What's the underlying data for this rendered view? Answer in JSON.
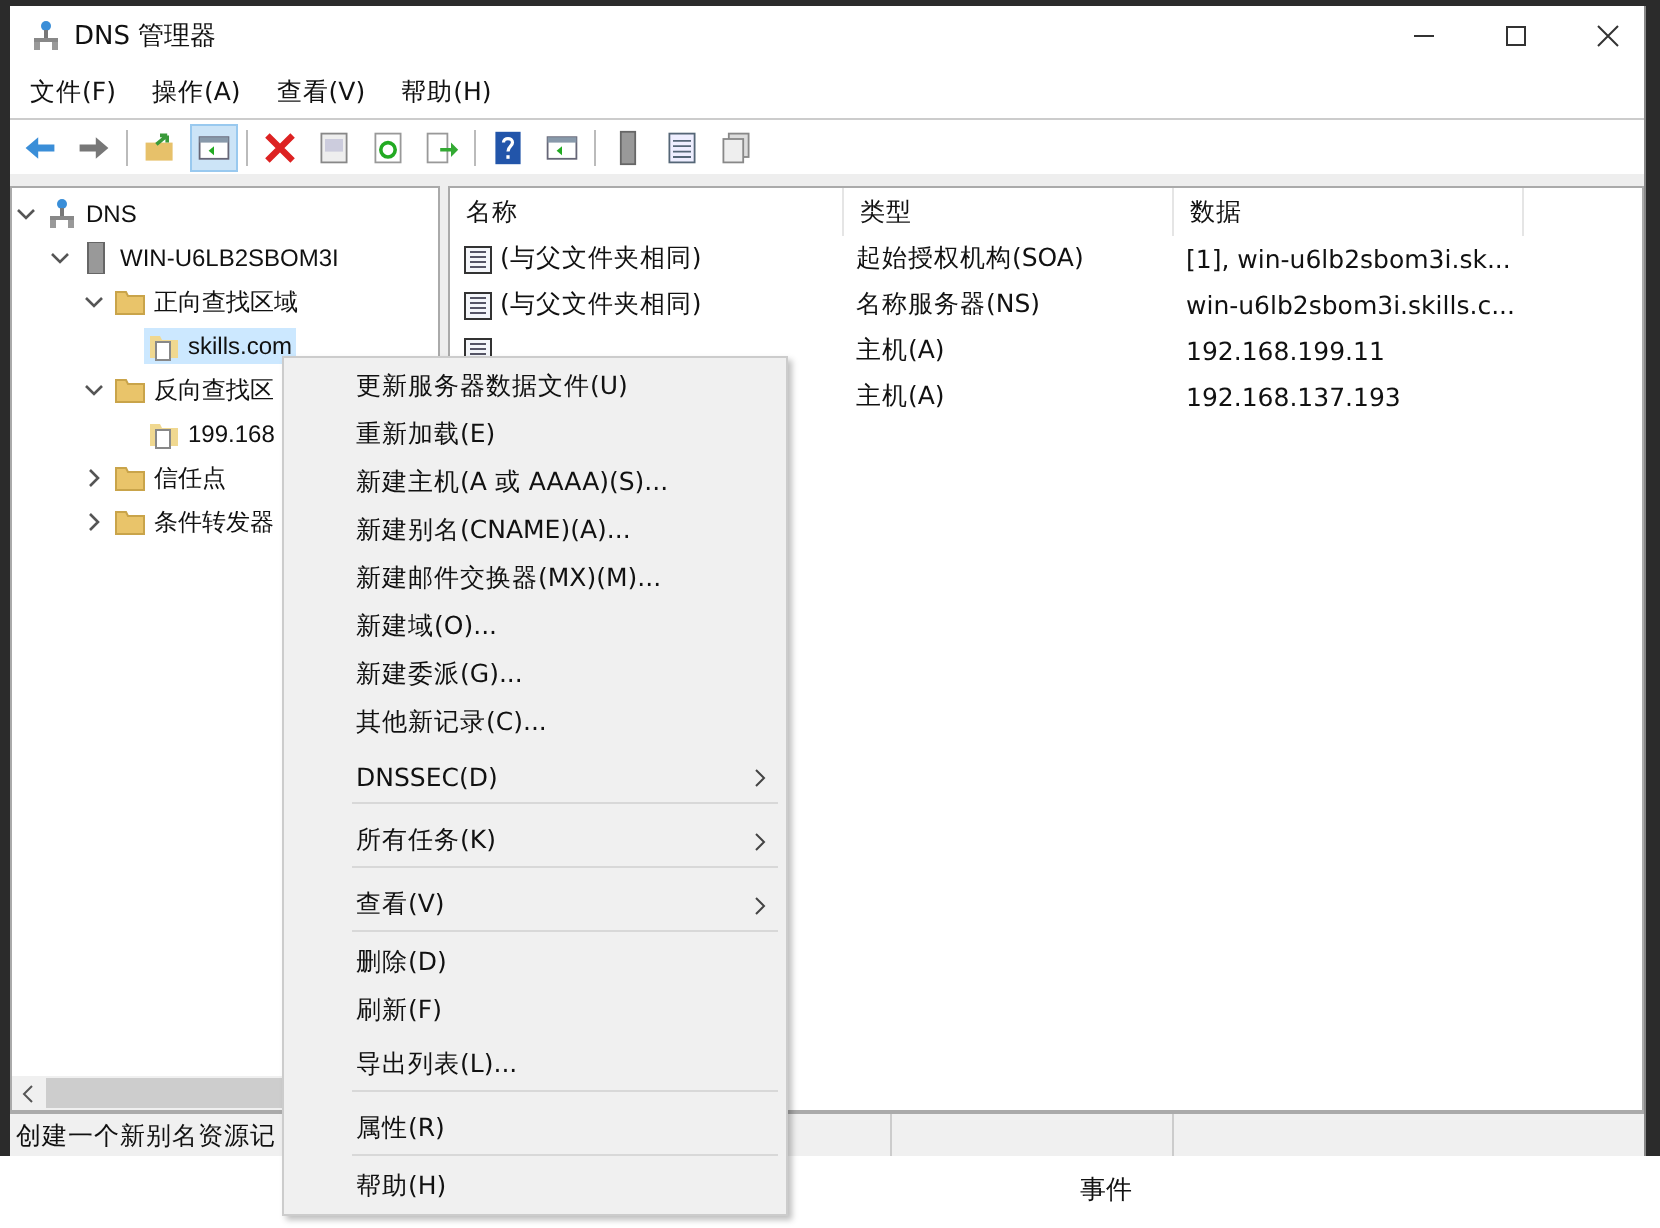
{
  "window": {
    "title": "DNS 管理器"
  },
  "menu": [
    "文件(F)",
    "操作(A)",
    "查看(V)",
    "帮助(H)"
  ],
  "tree": [
    {
      "label": "DNS",
      "kind": "root",
      "expanded": true,
      "selected": false,
      "children": [
        {
          "label": "WIN-U6LB2SBOM3I",
          "kind": "server",
          "expanded": true,
          "selected": false,
          "children": [
            {
              "label": "正向查找区域",
              "kind": "folder",
              "expanded": true,
              "selected": false,
              "children": [
                {
                  "label": "skills.com",
                  "kind": "zone",
                  "selected": true
                }
              ]
            },
            {
              "label": "反向查找区",
              "kind": "folder",
              "expanded": true,
              "selected": false,
              "children": [
                {
                  "label": "199.168",
                  "kind": "zone",
                  "selected": false
                }
              ]
            },
            {
              "label": "信任点",
              "kind": "folder",
              "expanded": false,
              "selected": false
            },
            {
              "label": "条件转发器",
              "kind": "folder",
              "expanded": false,
              "selected": false
            }
          ]
        }
      ]
    }
  ],
  "table": {
    "columns": [
      "名称",
      "类型",
      "数据"
    ],
    "rows": [
      {
        "name": "(与父文件夹相同)",
        "type": "起始授权机构(SOA)",
        "data": "[1], win-u6lb2sbom3i.sk..."
      },
      {
        "name": "(与父文件夹相同)",
        "type": "名称服务器(NS)",
        "data": "win-u6lb2sbom3i.skills.c..."
      },
      {
        "type": "主机(A)",
        "data": "192.168.199.11"
      },
      {
        "type": "主机(A)",
        "data": "192.168.137.193"
      }
    ]
  },
  "status_bar": "创建一个新别名资源记",
  "context_menu": [
    {
      "label": "更新服务器数据文件(U)",
      "submenu": false,
      "separator_after": false
    },
    {
      "label": "重新加载(E)",
      "submenu": false,
      "separator_after": false
    },
    {
      "label": "新建主机(A 或 AAAA)(S)...",
      "submenu": false,
      "separator_after": false
    },
    {
      "label": "新建别名(CNAME)(A)...",
      "submenu": false,
      "separator_after": false
    },
    {
      "label": "新建邮件交换器(MX)(M)...",
      "submenu": false,
      "separator_after": false
    },
    {
      "label": "新建域(O)...",
      "submenu": false,
      "separator_after": false
    },
    {
      "label": "新建委派(G)...",
      "submenu": false,
      "separator_after": false
    },
    {
      "label": "其他新记录(C)...",
      "submenu": false,
      "separator_after": false
    },
    {
      "label": "DNSSEC(D)",
      "submenu": true,
      "separator_after": true
    },
    {
      "label": "所有任务(K)",
      "submenu": true,
      "separator_after": true
    },
    {
      "label": "查看(V)",
      "submenu": true,
      "separator_after": true
    },
    {
      "label": "删除(D)",
      "submenu": false,
      "separator_after": false
    },
    {
      "label": "刷新(F)",
      "submenu": false,
      "separator_after": false
    },
    {
      "label": "导出列表(L)...",
      "submenu": false,
      "separator_after": true
    },
    {
      "label": "属性(R)",
      "submenu": false,
      "separator_after": true
    },
    {
      "label": "帮助(H)",
      "submenu": false,
      "separator_after": false
    }
  ],
  "background_window": {
    "column": "事件"
  }
}
